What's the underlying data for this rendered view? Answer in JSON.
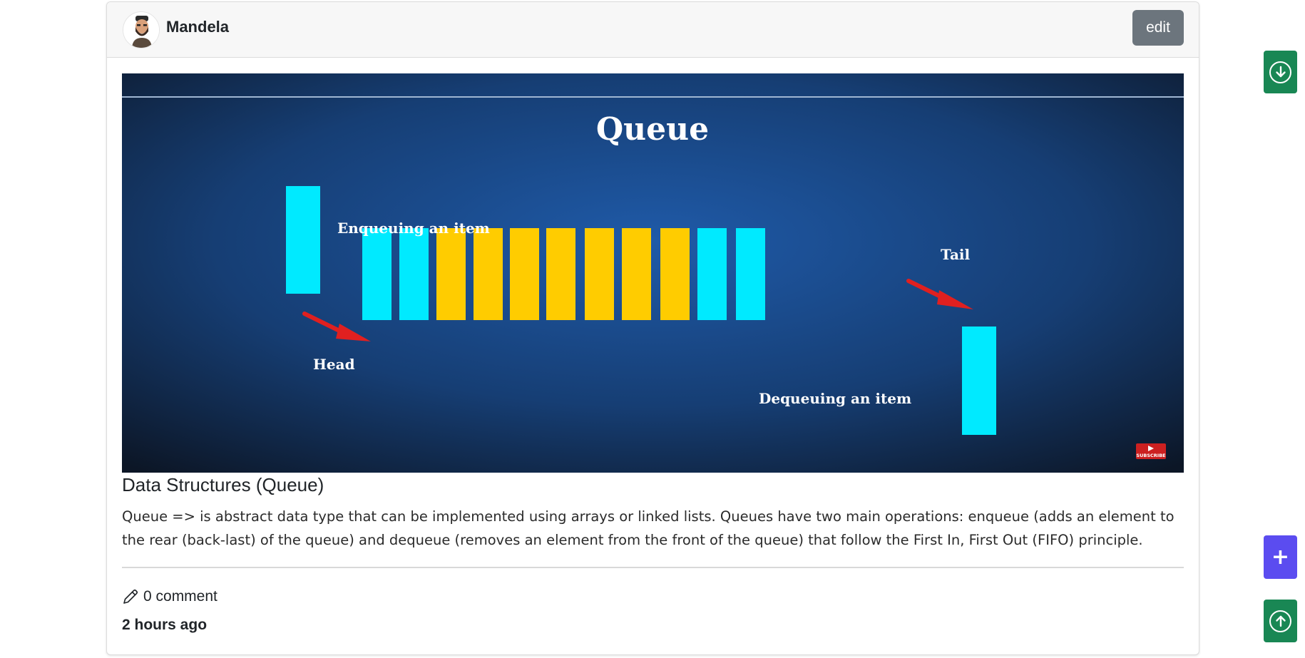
{
  "post": {
    "author": "Mandela",
    "edit_label": "edit",
    "image": {
      "title": "Queue",
      "enqueue_label": "Enqueuing an item",
      "head_label": "Head",
      "tail_label": "Tail",
      "dequeue_label": "Dequeuing an item",
      "subscribe_label": "SUBSCRIBE",
      "queue_item_colors": [
        "#00eaff",
        "#00eaff",
        "#ffcc00",
        "#ffcc00",
        "#ffcc00",
        "#ffcc00",
        "#ffcc00",
        "#ffcc00",
        "#ffcc00",
        "#00eaff",
        "#00eaff"
      ],
      "arrow_color": "#e02020"
    },
    "title": "Data Structures (Queue)",
    "body": "Queue => is abstract data type that can be implemented using arrays or linked lists. Queues have two main operations: enqueue (adds an element to the rear (back-last) of the queue) and dequeue (removes an element from the front of the queue) that follow the First In, First Out (FIFO) principle.",
    "comment_count": "0 comment",
    "time_ago": "2 hours ago"
  },
  "floating_buttons": {
    "down_icon": "arrow-down-circle-icon",
    "add_icon": "plus-icon",
    "up_icon": "arrow-up-circle-icon",
    "down_color": "#198754",
    "add_color": "#5b4cf0",
    "up_color": "#198754"
  }
}
